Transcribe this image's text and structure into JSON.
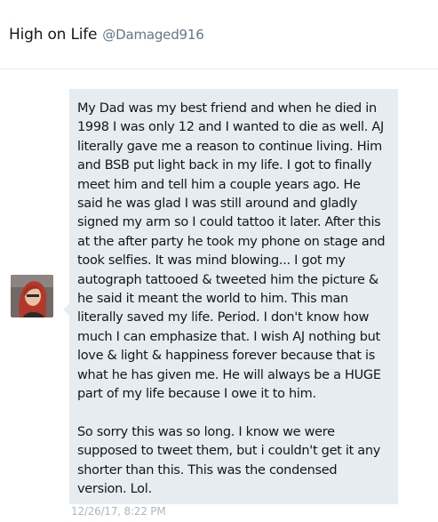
{
  "header": {
    "display_name": "High on Life",
    "handle": "@Damaged916"
  },
  "message": {
    "paragraphs": [
      "My Dad was my best friend and when he died in 1998 I was only 12 and I wanted to die as well. AJ literally gave me a reason to continue living. Him and BSB put light back in my life. I got to finally meet him and tell him a couple years ago. He said he was glad I was still around and gladly signed my arm so I could tattoo it later. After this at the after party he took my phone on stage and took selfies. It was mind blowing... I got my autograph tattooed & tweeted him the picture & he said it meant the world to him. This man literally saved my life. Period. I don't know how much I can emphasize that. I wish AJ nothing but love & light & happiness forever because that is what he has given me. He will always be a HUGE part of my life because I owe it to him.",
      "So sorry this was so long. I know we were supposed to tweet them, but i couldn't get it any shorter than this. This was the condensed version. Lol."
    ],
    "timestamp": "12/26/17, 8:22 PM"
  },
  "avatar": {
    "icon": "user-avatar-photo",
    "hair_color": "#b5372a",
    "background_color": "#6f6a66"
  },
  "colors": {
    "bubble": "#e6ecf0",
    "text": "#14171a",
    "muted": "#657786",
    "timestamp": "#aab8c2"
  }
}
